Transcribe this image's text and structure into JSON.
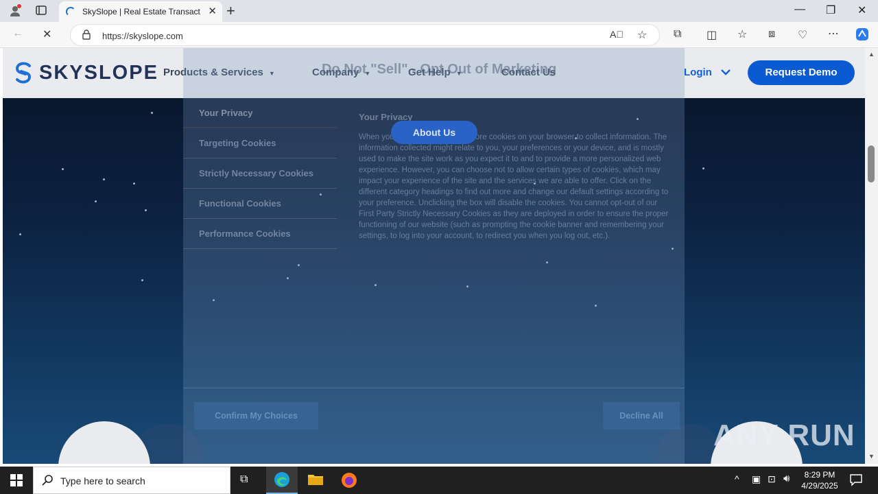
{
  "browser": {
    "tab_title": "SkySlope | Real Estate Transaction",
    "url": "https://skyslope.com"
  },
  "site": {
    "logo_text": "SKYSLOPE",
    "nav": [
      {
        "label": "Products & Services"
      },
      {
        "label": "Company"
      },
      {
        "label": "Get Help"
      },
      {
        "label": "Contact Us"
      }
    ],
    "login_label": "Login",
    "demo_label": "Request Demo",
    "about_label": "About Us"
  },
  "cookie_modal": {
    "title": "Do Not \"Sell\" - Opt Out of Marketing",
    "categories": [
      "Your Privacy",
      "Targeting Cookies",
      "Strictly Necessary Cookies",
      "Functional Cookies",
      "Performance Cookies"
    ],
    "section_heading": "Your Privacy",
    "section_body": "When you visit our website, we store cookies on your browser to collect information. The information collected might relate to you, your preferences or your device, and is mostly used to make the site work as you expect it to and to provide a more personalized web experience. However, you can choose not to allow certain types of cookies, which may impact your experience of the site and the services we are able to offer. Click on the different category headings to find out more and change our default settings according to your preference. Unclicking the box will disable the cookies. You cannot opt-out of our First Party Strictly Necessary Cookies as they are deployed in order to ensure the proper functioning of our website (such as prompting the cookie banner and remembering your settings, to log into your account, to redirect you when you log out, etc.).",
    "confirm_label": "Confirm My Choices",
    "decline_label": "Decline All"
  },
  "watermark": "ANY RUN",
  "taskbar": {
    "search_placeholder": "Type here to search",
    "time": "8:29 PM",
    "date": "4/29/2025"
  }
}
